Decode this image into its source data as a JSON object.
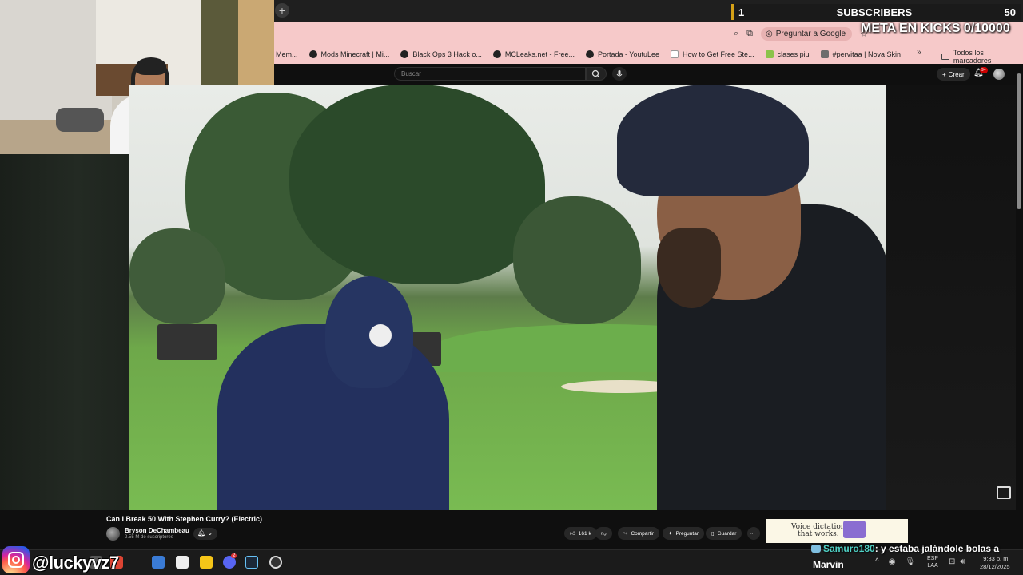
{
  "browser": {
    "new_tab": "+",
    "window_controls": [
      "–",
      "▢",
      "✕"
    ],
    "ask_google": "Preguntar a Google",
    "bookmarks": [
      {
        "label": "Mem...",
        "icon": "none"
      },
      {
        "label": "Mods Minecraft | Mi...",
        "icon": "circle"
      },
      {
        "label": "Black Ops 3 Hack o...",
        "icon": "circle"
      },
      {
        "label": "MCLeaks.net - Free...",
        "icon": "circle"
      },
      {
        "label": "Portada - YoutuLee",
        "icon": "circle"
      },
      {
        "label": "How to Get Free Ste...",
        "icon": "square"
      },
      {
        "label": "clases piu",
        "icon": "yellow"
      },
      {
        "label": "#pervitaa | Nova Skin",
        "icon": "lines"
      }
    ],
    "bookmarks_more": "»",
    "all_bookmarks": "Todos los marcadores"
  },
  "youtube": {
    "search_placeholder": "Buscar",
    "create_label": "Crear",
    "notif_count": "9+",
    "video": {
      "title": "Can I Break 50 With Stephen Curry? (Electric)",
      "channel": "Bryson DeChambeau",
      "subscribers": "2.55 M de suscriptores",
      "likes": "161 k",
      "share": "Compartir",
      "ask": "Preguntar",
      "save": "Guardar",
      "more": "···"
    }
  },
  "stream_overlay": {
    "subs_count": "1",
    "subs_label": "SUBSCRIBERS",
    "subs_right": "50",
    "meta": "META EN KICKS 0/10000",
    "instagram_handle": "@luckyvz7",
    "chat_user": "Samuro180",
    "chat_message": ": y estaba jalándole bolas a",
    "chat_next_user": "Marvin",
    "ad_text_line1": "Voice dictation",
    "ad_text_line2": "that works."
  },
  "taskbar": {
    "lang_line1": "ESP",
    "lang_line2": "LAA",
    "time": "9:33 p. m.",
    "date": "28/12/2025",
    "discord_badge": "2"
  }
}
